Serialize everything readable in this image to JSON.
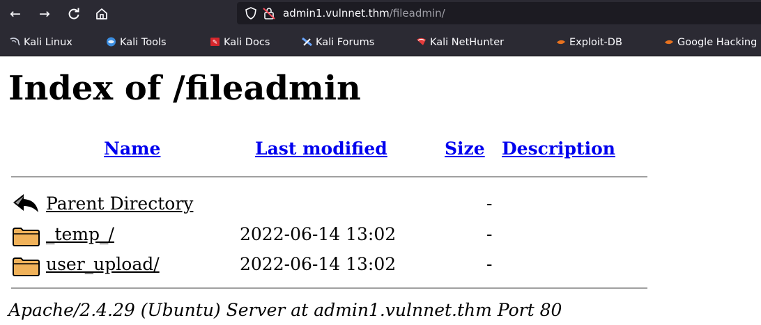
{
  "browser": {
    "url_host": "admin1.vulnnet.thm",
    "url_path": "/fileadmin/",
    "bookmarks": [
      {
        "label": "Kali Linux",
        "icon": "kali-dragon-icon"
      },
      {
        "label": "Kali Tools",
        "icon": "kali-tools-icon"
      },
      {
        "label": "Kali Docs",
        "icon": "kali-docs-icon"
      },
      {
        "label": "Kali Forums",
        "icon": "kali-forums-icon"
      },
      {
        "label": "Kali NetHunter",
        "icon": "kali-nethunter-icon"
      },
      {
        "label": "Exploit-DB",
        "icon": "exploit-db-icon"
      },
      {
        "label": "Google Hacking DB",
        "icon": "ghdb-icon"
      }
    ]
  },
  "page": {
    "title": "Index of /fileadmin",
    "columns": {
      "name": "Name",
      "last_modified": "Last modified",
      "size": "Size",
      "description": "Description"
    },
    "rows": [
      {
        "name": "Parent Directory",
        "modified": "",
        "size": "-",
        "icon": "back-arrow-icon"
      },
      {
        "name": "_temp_/",
        "modified": "2022-06-14 13:02",
        "size": "-",
        "icon": "folder-icon"
      },
      {
        "name": "user_upload/",
        "modified": "2022-06-14 13:02",
        "size": "-",
        "icon": "folder-icon"
      }
    ],
    "footer": "Apache/2.4.29 (Ubuntu) Server at admin1.vulnnet.thm Port 80"
  },
  "colors": {
    "link": "#0000ee",
    "visited_link": "#551a8b",
    "chrome_bg": "#2b2a33"
  }
}
